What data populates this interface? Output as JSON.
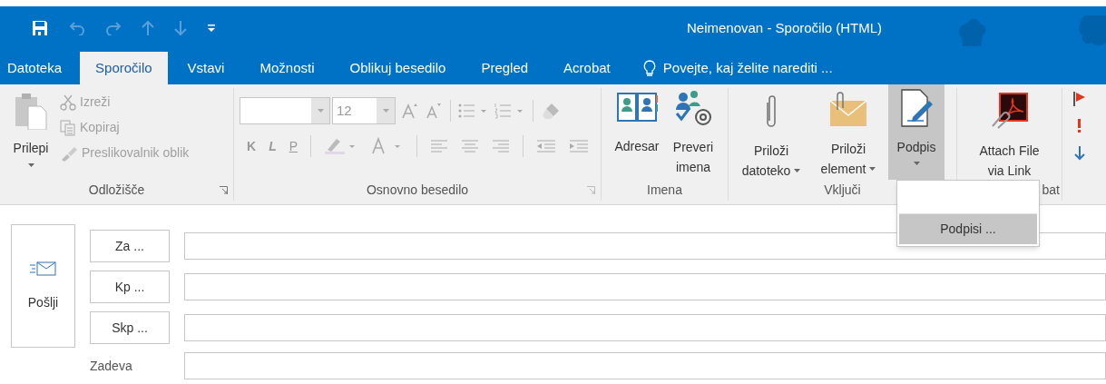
{
  "window": {
    "title": "Neimenovan - Sporočilo (HTML)"
  },
  "tabs": [
    {
      "label": "Datoteka",
      "selected": false
    },
    {
      "label": "Sporočilo",
      "selected": true
    },
    {
      "label": "Vstavi",
      "selected": false
    },
    {
      "label": "Možnosti",
      "selected": false
    },
    {
      "label": "Oblikuj besedilo",
      "selected": false
    },
    {
      "label": "Pregled",
      "selected": false
    },
    {
      "label": "Acrobat",
      "selected": false
    }
  ],
  "tell_me": "Povejte, kaj želite narediti ...",
  "clipboard": {
    "label": "Odložišče",
    "paste": "Prilepi",
    "items": [
      {
        "label": "Izreži",
        "disabled": true
      },
      {
        "label": "Kopiraj",
        "disabled": true
      },
      {
        "label": "Preslikovalnik oblik",
        "disabled": true
      }
    ]
  },
  "basic_text": {
    "label": "Osnovno besedilo",
    "font_size": "12",
    "bold": "K",
    "italic": "L",
    "underline": "P"
  },
  "names": {
    "label": "Imena",
    "address_book": "Adresar",
    "check_names": [
      "Preveri",
      "imena"
    ]
  },
  "include": {
    "label": "Vključi",
    "attach_file": [
      "Priloži",
      "datoteko"
    ],
    "attach_item": [
      "Priloži",
      "element"
    ],
    "signature": "Podpis",
    "signature_pressed": true
  },
  "acrobat": {
    "label": "bat",
    "attach": [
      "Attach File",
      "via Link"
    ]
  },
  "signature_menu": {
    "items": [
      "Podpisi ..."
    ]
  },
  "compose": {
    "send": "Pošlji",
    "to": "Za ...",
    "cc": "Kp ...",
    "bcc": "Skp ...",
    "subject": "Zadeva"
  }
}
